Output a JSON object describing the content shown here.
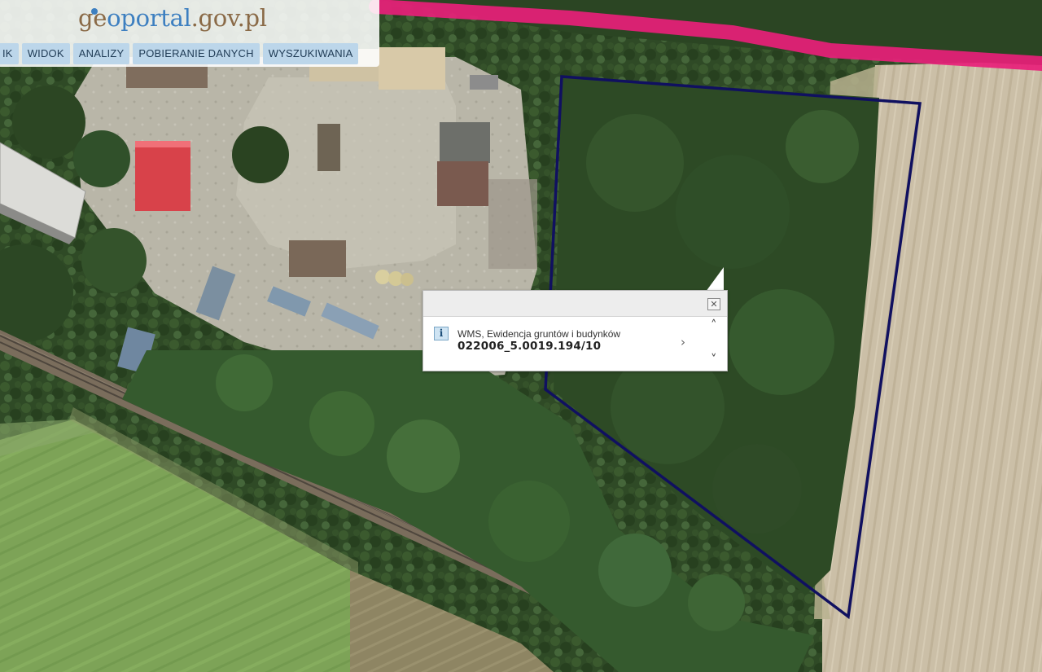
{
  "logo": {
    "part1": "ge",
    "part2": "oportal",
    "part3": ".gov.pl"
  },
  "menu": {
    "items": [
      {
        "label": "IK"
      },
      {
        "label": "WIDOK"
      },
      {
        "label": "ANALIZY"
      },
      {
        "label": "POBIERANIE DANYCH"
      },
      {
        "label": "WYSZUKIWANIA"
      }
    ]
  },
  "popup": {
    "close_symbol": "✕",
    "info_icon": "i",
    "layer_name": "WMS, Ewidencja gruntów i budynków",
    "parcel_id": "022006_5.0019.194/10",
    "next_symbol": "›",
    "up_symbol": "˄",
    "down_symbol": "˅"
  },
  "colors": {
    "parcel_outline": "#101060",
    "highlight_line": "#e8207a",
    "menu_bg": "#bcd6ea"
  },
  "icons": [
    "info-icon",
    "close-icon",
    "chevron-right-icon",
    "chevron-up-icon",
    "chevron-down-icon"
  ]
}
